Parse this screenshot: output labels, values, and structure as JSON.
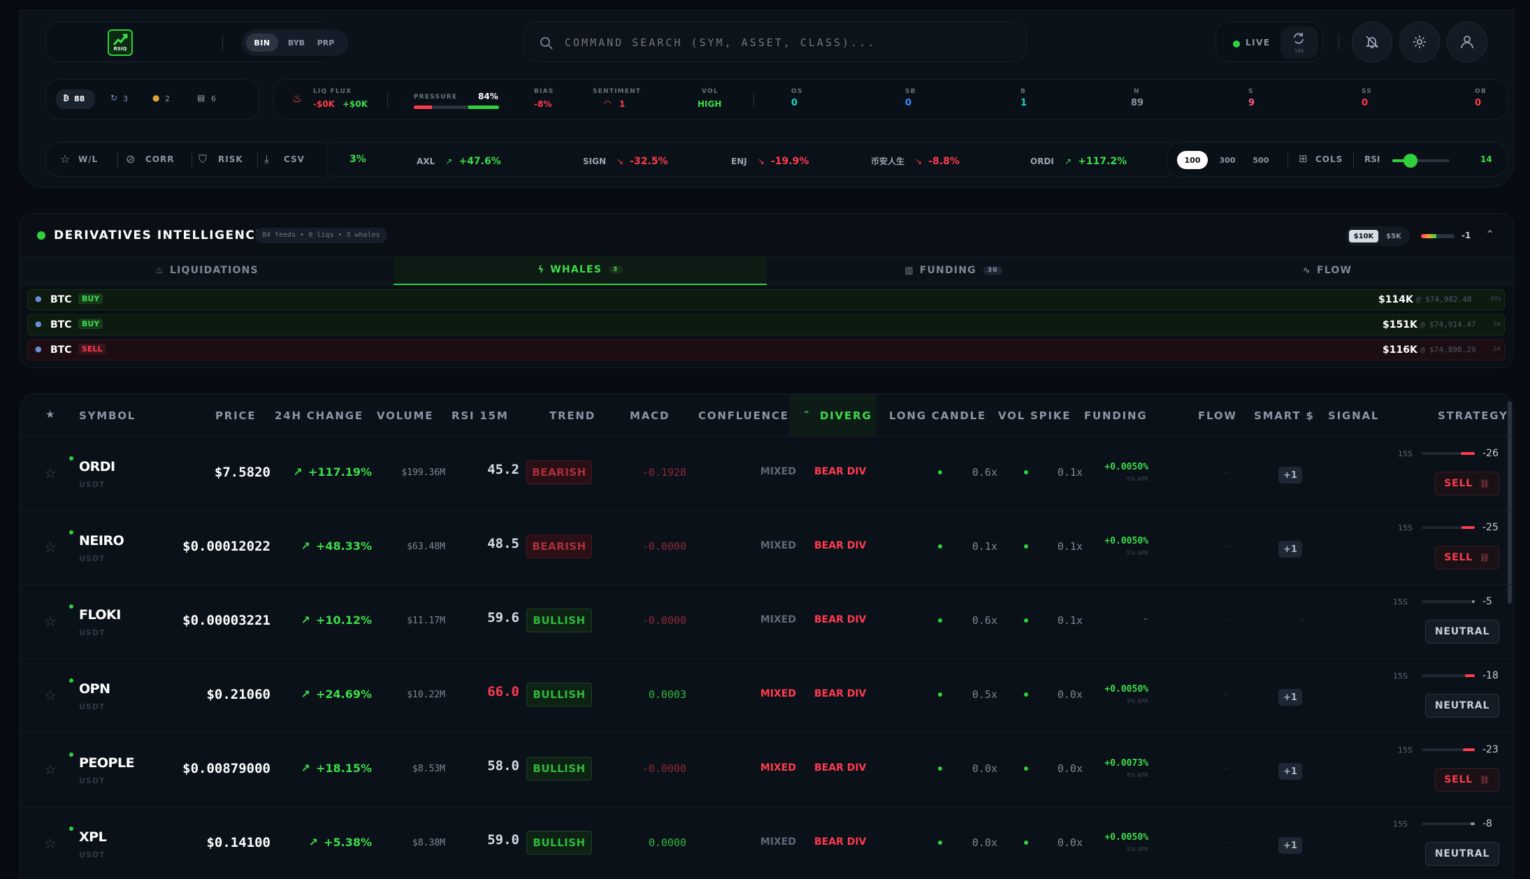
{
  "header": {
    "logo_text": "RSIQ",
    "exchanges": [
      "BIN",
      "BYB",
      "PRP"
    ],
    "search_placeholder": "COMMAND SEARCH (SYM, ASSET, CLASS)...",
    "live_label": "LIVE",
    "refresh_sub": "13S"
  },
  "stats": {
    "counters": [
      {
        "icon": "bitcoin-icon",
        "value": "88"
      },
      {
        "icon": "cycle-icon",
        "value": "3"
      },
      {
        "icon": "medal-icon",
        "value": "2"
      },
      {
        "icon": "chart-icon",
        "value": "6"
      }
    ],
    "liq_flux_label": "LIQ FLUX",
    "liq_flux_neg": "-$0K",
    "liq_flux_pos": "+$0K",
    "pressure_label": "PRESSURE",
    "pressure_value": "84%",
    "pressure_fraction": 0.84,
    "bias_label": "BIAS",
    "bias_value": "-8%",
    "sentiment_label": "SENTIMENT",
    "sentiment_value": "1",
    "vol_label": "VOL",
    "vol_value": "HIGH",
    "zones": [
      {
        "label": "OS",
        "value": "0",
        "color": "#19d3c5"
      },
      {
        "label": "SB",
        "value": "0",
        "color": "#3b8cff"
      },
      {
        "label": "B",
        "value": "1",
        "color": "#19d3c5"
      },
      {
        "label": "N",
        "value": "89",
        "color": "#8b95a5"
      },
      {
        "label": "S",
        "value": "9",
        "color": "#ff5a78"
      },
      {
        "label": "SS",
        "value": "0",
        "color": "#ff3b4e"
      },
      {
        "label": "OB",
        "value": "0",
        "color": "#ff3b4e"
      }
    ]
  },
  "toolbar": {
    "wl": "W/L",
    "corr": "CORR",
    "risk": "RISK",
    "csv": "CSV",
    "ticker_partial": "3%",
    "tickers": [
      {
        "sym": "AXL",
        "change": "+47.6%",
        "dir": "up"
      },
      {
        "sym": "SIGN",
        "change": "-32.5%",
        "dir": "down"
      },
      {
        "sym": "ENJ",
        "change": "-19.9%",
        "dir": "down"
      },
      {
        "sym": "币安人生",
        "change": "-8.8%",
        "dir": "down"
      },
      {
        "sym": "ORDI",
        "change": "+117.2%",
        "dir": "up"
      }
    ],
    "limits": [
      "100",
      "300",
      "500"
    ],
    "cols": "COLS",
    "rsi_label": "RSI",
    "rsi_value": "14"
  },
  "deriv": {
    "title": "DERIVATIVES INTELLIGENCE",
    "meta": "84 feeds • 0 liqs • 3 whales",
    "thresholds": [
      "$10K",
      "$5K"
    ],
    "score": "-1",
    "tabs": [
      {
        "label": "LIQUIDATIONS",
        "badge": ""
      },
      {
        "label": "WHALES",
        "badge": "3"
      },
      {
        "label": "FUNDING",
        "badge": "30"
      },
      {
        "label": "FLOW",
        "badge": ""
      }
    ],
    "feeds": [
      {
        "sym": "BTC",
        "side": "BUY",
        "amount": "$114K",
        "price": "@ $74,982.48",
        "age": "40s"
      },
      {
        "sym": "BTC",
        "side": "BUY",
        "amount": "$151K",
        "price": "@ $74,914.47",
        "age": "1m"
      },
      {
        "sym": "BTC",
        "side": "SELL",
        "amount": "$116K",
        "price": "@ $74,898.29",
        "age": "1m"
      }
    ]
  },
  "table": {
    "star_header": "★",
    "headers": [
      "SYMBOL",
      "PRICE",
      "24H CHANGE",
      "VOLUME",
      "RSI 15M",
      "TREND",
      "MACD",
      "CONFLUENCE",
      "DIVERG",
      "LONG CANDLE",
      "VOL SPIKE",
      "FUNDING",
      "FLOW",
      "SMART $",
      "SIGNAL",
      "STRATEGY"
    ],
    "rows": [
      {
        "sym": "ORDI",
        "quote": "USDT",
        "price": "$7.5820",
        "change": "+117.19%",
        "volume": "$199.36M",
        "rsi": "45.2",
        "rsi_hot": false,
        "trend": "BEARISH",
        "macd": "-0.1928",
        "macd_pos": false,
        "confluence": "MIXED",
        "conf_hot": false,
        "diverg": "BEAR DIV",
        "long_candle": "0.6x",
        "vol_spike": "0.1x",
        "funding": "+0.0050%",
        "apr": "5% APR",
        "flow": "-",
        "smart": "+1",
        "strat_tf": "15S",
        "strat_score": "-26",
        "strat_fill": 0.26,
        "signal": "SELL"
      },
      {
        "sym": "NEIRO",
        "quote": "USDT",
        "price": "$0.00012022",
        "change": "+48.33%",
        "volume": "$63.48M",
        "rsi": "48.5",
        "rsi_hot": false,
        "trend": "BEARISH",
        "macd": "-0.0000",
        "macd_pos": false,
        "confluence": "MIXED",
        "conf_hot": false,
        "diverg": "BEAR DIV",
        "long_candle": "0.1x",
        "vol_spike": "0.1x",
        "funding": "+0.0050%",
        "apr": "5% APR",
        "flow": "-",
        "smart": "+1",
        "strat_tf": "15S",
        "strat_score": "-25",
        "strat_fill": 0.25,
        "signal": "SELL"
      },
      {
        "sym": "FLOKI",
        "quote": "USDT",
        "price": "$0.00003221",
        "change": "+10.12%",
        "volume": "$11.17M",
        "rsi": "59.6",
        "rsi_hot": false,
        "trend": "BULLISH",
        "macd": "-0.0000",
        "macd_pos": false,
        "confluence": "MIXED",
        "conf_hot": false,
        "diverg": "BEAR DIV",
        "long_candle": "0.6x",
        "vol_spike": "0.1x",
        "funding": "-",
        "apr": "",
        "flow": "-",
        "smart": "-",
        "strat_tf": "15S",
        "strat_score": "-5",
        "strat_fill": 0.05,
        "signal": "NEUTRAL"
      },
      {
        "sym": "OPN",
        "quote": "USDT",
        "price": "$0.21060",
        "change": "+24.69%",
        "volume": "$10.22M",
        "rsi": "66.0",
        "rsi_hot": true,
        "trend": "BULLISH",
        "macd": "0.0003",
        "macd_pos": true,
        "confluence": "MIXED",
        "conf_hot": true,
        "diverg": "BEAR DIV",
        "long_candle": "0.5x",
        "vol_spike": "0.0x",
        "funding": "+0.0050%",
        "apr": "5% APR",
        "flow": "-",
        "smart": "+1",
        "strat_tf": "15S",
        "strat_score": "-18",
        "strat_fill": 0.18,
        "signal": "NEUTRAL"
      },
      {
        "sym": "PEOPLE",
        "quote": "USDT",
        "price": "$0.00879000",
        "change": "+18.15%",
        "volume": "$8.53M",
        "rsi": "58.0",
        "rsi_hot": false,
        "trend": "BULLISH",
        "macd": "-0.0000",
        "macd_pos": false,
        "confluence": "MIXED",
        "conf_hot": true,
        "diverg": "BEAR DIV",
        "long_candle": "0.0x",
        "vol_spike": "0.0x",
        "funding": "+0.0073%",
        "apr": "8% APR",
        "flow": "-",
        "smart": "+1",
        "strat_tf": "15S",
        "strat_score": "-23",
        "strat_fill": 0.23,
        "signal": "SELL"
      },
      {
        "sym": "XPL",
        "quote": "USDT",
        "price": "$0.14100",
        "change": "+5.38%",
        "volume": "$8.38M",
        "rsi": "59.0",
        "rsi_hot": false,
        "trend": "BULLISH",
        "macd": "0.0000",
        "macd_pos": true,
        "confluence": "MIXED",
        "conf_hot": false,
        "diverg": "BEAR DIV",
        "long_candle": "0.0x",
        "vol_spike": "0.0x",
        "funding": "+0.0050%",
        "apr": "5% APR",
        "flow": "-",
        "smart": "+1",
        "strat_tf": "15S",
        "strat_score": "-8",
        "strat_fill": 0.08,
        "signal": "NEUTRAL"
      }
    ]
  }
}
